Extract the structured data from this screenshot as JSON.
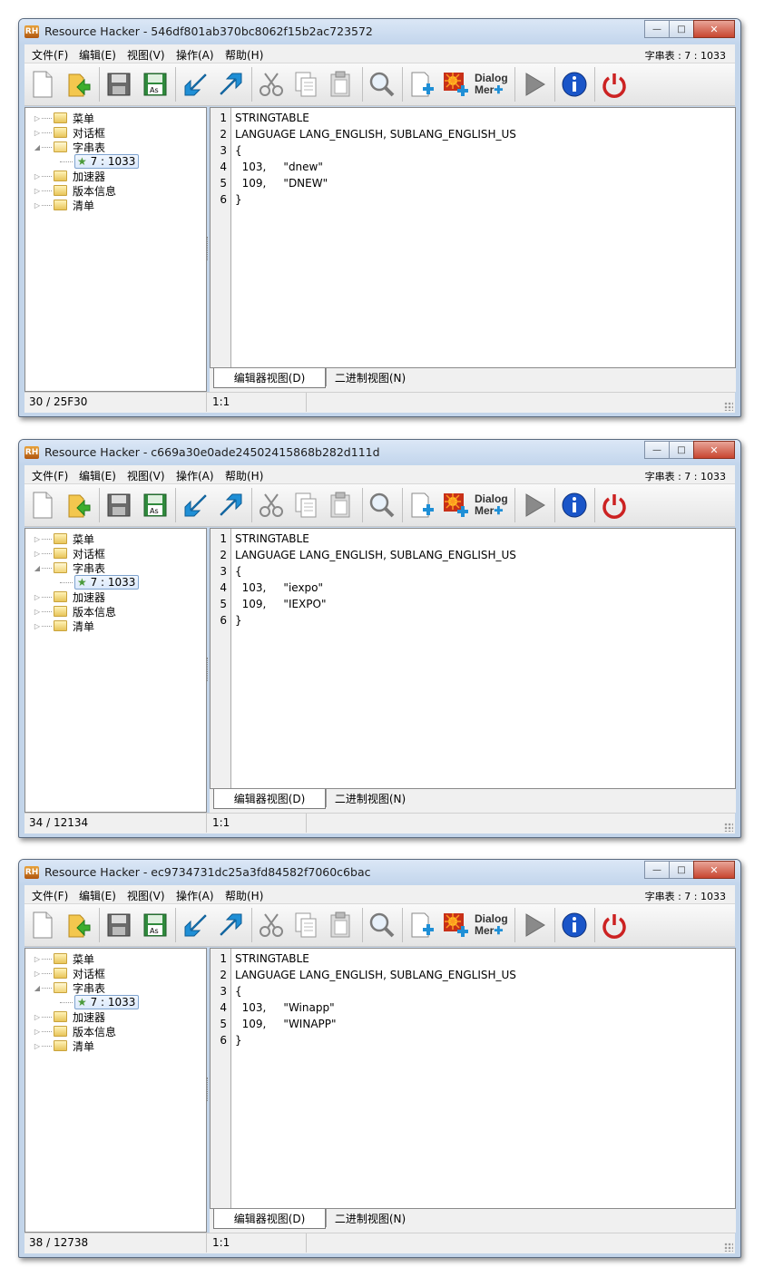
{
  "app": {
    "menu": [
      "文件(F)",
      "编辑(E)",
      "视图(V)",
      "操作(A)",
      "帮助(H)"
    ],
    "window_buttons": {
      "minimize": "—",
      "maximize": "□",
      "close": "✕"
    },
    "logo_text": "RH",
    "toolbar": {
      "dialog_label_1": "Dialog",
      "dialog_label_2": "Mer"
    },
    "tree_labels": [
      "菜单",
      "对话框",
      "字串表",
      "加速器",
      "版本信息",
      "清单"
    ],
    "tree_selected": "7 : 1033",
    "tabs": [
      "编辑器视图(D)",
      "二进制视图(N)"
    ],
    "accent_colors": {
      "power": "#cc2222",
      "info": "#1a55c8",
      "play": "#8a8a8a"
    }
  },
  "windows": [
    {
      "title": "Resource Hacker - 546df801ab370bc8062f15b2ac723572",
      "menu_status": "字串表 : 7 : 1033",
      "code_lines": [
        "STRINGTABLE",
        "LANGUAGE LANG_ENGLISH, SUBLANG_ENGLISH_US",
        "{",
        "  103,     \"dnew\"",
        "  109,     \"DNEW\"",
        "}"
      ],
      "line_numbers": [
        "1",
        "2",
        "3",
        "4",
        "5",
        "6"
      ],
      "status_left": "30 / 25F30",
      "status_cursor": "1:1"
    },
    {
      "title": "Resource Hacker - c669a30e0ade24502415868b282d111d",
      "menu_status": "字串表 : 7 : 1033",
      "code_lines": [
        "STRINGTABLE",
        "LANGUAGE LANG_ENGLISH, SUBLANG_ENGLISH_US",
        "{",
        "  103,     \"iexpo\"",
        "  109,     \"IEXPO\"",
        "}"
      ],
      "line_numbers": [
        "1",
        "2",
        "3",
        "4",
        "5",
        "6"
      ],
      "status_left": "34 / 12134",
      "status_cursor": "1:1"
    },
    {
      "title": "Resource Hacker - ec9734731dc25a3fd84582f7060c6bac",
      "menu_status": "字串表 : 7 : 1033",
      "code_lines": [
        "STRINGTABLE",
        "LANGUAGE LANG_ENGLISH, SUBLANG_ENGLISH_US",
        "{",
        "  103,     \"Winapp\"",
        "  109,     \"WINAPP\"",
        "}"
      ],
      "line_numbers": [
        "1",
        "2",
        "3",
        "4",
        "5",
        "6"
      ],
      "status_left": "38 / 12738",
      "status_cursor": "1:1"
    }
  ]
}
